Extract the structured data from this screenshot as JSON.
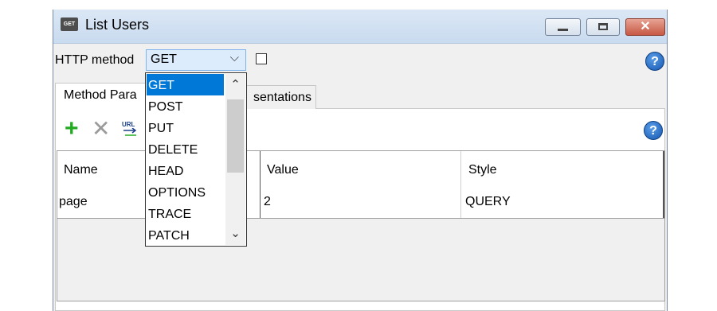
{
  "window": {
    "title": "List Users",
    "app_icon_text": "GET",
    "close_glyph": "✕",
    "help_glyph": "?"
  },
  "method_row": {
    "label": "HTTP method",
    "selected": "GET",
    "chevron": "⌵"
  },
  "tabs": [
    {
      "label": "Method Para"
    },
    {
      "label": "sentations"
    }
  ],
  "toolbar": {
    "add_glyph": "+",
    "remove_glyph": "✕",
    "url_glyph": "URL"
  },
  "grid": {
    "columns": [
      "Name",
      "Value",
      "Style"
    ],
    "rows": [
      {
        "name": "page",
        "value": "2",
        "style": "QUERY"
      }
    ]
  },
  "dropdown": {
    "options": [
      "GET",
      "POST",
      "PUT",
      "DELETE",
      "HEAD",
      "OPTIONS",
      "TRACE",
      "PATCH"
    ],
    "selected_index": 0,
    "scroll_up": "⌃",
    "scroll_down": "⌄"
  },
  "colors": {
    "selection": "#0078d7",
    "add": "#22aa22",
    "close_button": "#c75844"
  }
}
